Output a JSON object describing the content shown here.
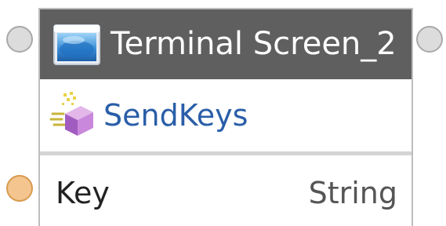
{
  "node": {
    "title": "Terminal Screen_2",
    "header_icon": "terminal-screen-icon",
    "activity": {
      "label": "SendKeys",
      "icon": "send-keys-icon"
    },
    "parameters": [
      {
        "name": "Key",
        "type": "String"
      }
    ]
  },
  "colors": {
    "header_bg": "#5f5f5f",
    "title_text": "#ffffff",
    "activity_text": "#2a5ea8",
    "port_default": "#dcdcdc",
    "port_parameter": "#f4c58f"
  }
}
